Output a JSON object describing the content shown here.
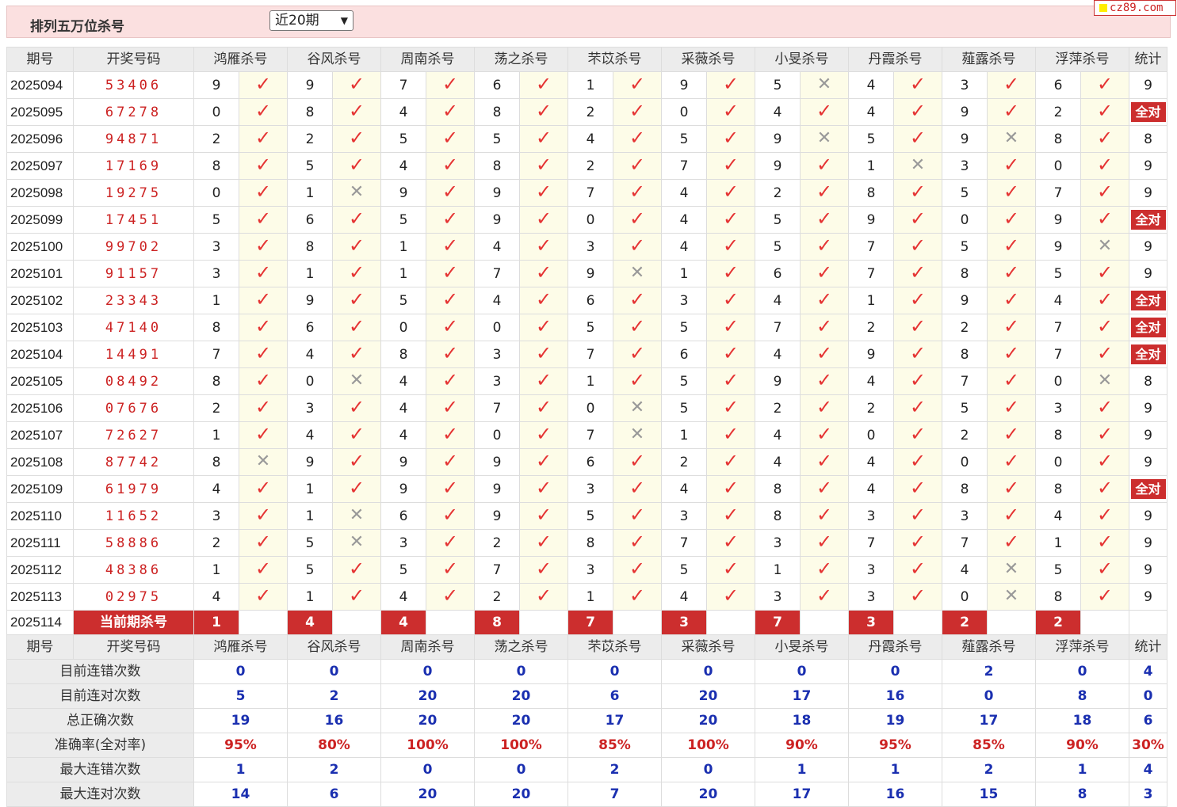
{
  "header": {
    "title": "排列五万位杀号",
    "period_select": "近20期",
    "watermark": "cz89.com"
  },
  "columns": {
    "issue": "期号",
    "draw": "开奖号码",
    "experts": [
      "鸿雁杀号",
      "谷风杀号",
      "周南杀号",
      "荡之杀号",
      "芣苡杀号",
      "采薇杀号",
      "小旻杀号",
      "丹霞杀号",
      "薤露杀号",
      "浮萍杀号"
    ],
    "stat": "统计"
  },
  "all_right_label": "全对",
  "rows": [
    {
      "issue": "2025094",
      "draw": "53406",
      "kills": [
        "9",
        "9",
        "7",
        "6",
        "1",
        "9",
        "5",
        "4",
        "3",
        "6"
      ],
      "ok": [
        1,
        1,
        1,
        1,
        1,
        1,
        0,
        1,
        1,
        1
      ],
      "sum": "9"
    },
    {
      "issue": "2025095",
      "draw": "67278",
      "kills": [
        "0",
        "8",
        "4",
        "8",
        "2",
        "0",
        "4",
        "4",
        "9",
        "2"
      ],
      "ok": [
        1,
        1,
        1,
        1,
        1,
        1,
        1,
        1,
        1,
        1
      ],
      "sum": "全对"
    },
    {
      "issue": "2025096",
      "draw": "94871",
      "kills": [
        "2",
        "2",
        "5",
        "5",
        "4",
        "5",
        "9",
        "5",
        "9",
        "8"
      ],
      "ok": [
        1,
        1,
        1,
        1,
        1,
        1,
        0,
        1,
        0,
        1
      ],
      "sum": "8"
    },
    {
      "issue": "2025097",
      "draw": "17169",
      "kills": [
        "8",
        "5",
        "4",
        "8",
        "2",
        "7",
        "9",
        "1",
        "3",
        "0"
      ],
      "ok": [
        1,
        1,
        1,
        1,
        1,
        1,
        1,
        0,
        1,
        1
      ],
      "sum": "9"
    },
    {
      "issue": "2025098",
      "draw": "19275",
      "kills": [
        "0",
        "1",
        "9",
        "9",
        "7",
        "4",
        "2",
        "8",
        "5",
        "7"
      ],
      "ok": [
        1,
        0,
        1,
        1,
        1,
        1,
        1,
        1,
        1,
        1
      ],
      "sum": "9"
    },
    {
      "issue": "2025099",
      "draw": "17451",
      "kills": [
        "5",
        "6",
        "5",
        "9",
        "0",
        "4",
        "5",
        "9",
        "0",
        "9"
      ],
      "ok": [
        1,
        1,
        1,
        1,
        1,
        1,
        1,
        1,
        1,
        1
      ],
      "sum": "全对"
    },
    {
      "issue": "2025100",
      "draw": "99702",
      "kills": [
        "3",
        "8",
        "1",
        "4",
        "3",
        "4",
        "5",
        "7",
        "5",
        "9"
      ],
      "ok": [
        1,
        1,
        1,
        1,
        1,
        1,
        1,
        1,
        1,
        0
      ],
      "sum": "9"
    },
    {
      "issue": "2025101",
      "draw": "91157",
      "kills": [
        "3",
        "1",
        "1",
        "7",
        "9",
        "1",
        "6",
        "7",
        "8",
        "5"
      ],
      "ok": [
        1,
        1,
        1,
        1,
        0,
        1,
        1,
        1,
        1,
        1
      ],
      "sum": "9"
    },
    {
      "issue": "2025102",
      "draw": "23343",
      "kills": [
        "1",
        "9",
        "5",
        "4",
        "6",
        "3",
        "4",
        "1",
        "9",
        "4"
      ],
      "ok": [
        1,
        1,
        1,
        1,
        1,
        1,
        1,
        1,
        1,
        1
      ],
      "sum": "全对"
    },
    {
      "issue": "2025103",
      "draw": "47140",
      "kills": [
        "8",
        "6",
        "0",
        "0",
        "5",
        "5",
        "7",
        "2",
        "2",
        "7"
      ],
      "ok": [
        1,
        1,
        1,
        1,
        1,
        1,
        1,
        1,
        1,
        1
      ],
      "sum": "全对"
    },
    {
      "issue": "2025104",
      "draw": "14491",
      "kills": [
        "7",
        "4",
        "8",
        "3",
        "7",
        "6",
        "4",
        "9",
        "8",
        "7"
      ],
      "ok": [
        1,
        1,
        1,
        1,
        1,
        1,
        1,
        1,
        1,
        1
      ],
      "sum": "全对"
    },
    {
      "issue": "2025105",
      "draw": "08492",
      "kills": [
        "8",
        "0",
        "4",
        "3",
        "1",
        "5",
        "9",
        "4",
        "7",
        "0"
      ],
      "ok": [
        1,
        0,
        1,
        1,
        1,
        1,
        1,
        1,
        1,
        0
      ],
      "sum": "8"
    },
    {
      "issue": "2025106",
      "draw": "07676",
      "kills": [
        "2",
        "3",
        "4",
        "7",
        "0",
        "5",
        "2",
        "2",
        "5",
        "3"
      ],
      "ok": [
        1,
        1,
        1,
        1,
        0,
        1,
        1,
        1,
        1,
        1
      ],
      "sum": "9"
    },
    {
      "issue": "2025107",
      "draw": "72627",
      "kills": [
        "1",
        "4",
        "4",
        "0",
        "7",
        "1",
        "4",
        "0",
        "2",
        "8"
      ],
      "ok": [
        1,
        1,
        1,
        1,
        0,
        1,
        1,
        1,
        1,
        1
      ],
      "sum": "9"
    },
    {
      "issue": "2025108",
      "draw": "87742",
      "kills": [
        "8",
        "9",
        "9",
        "9",
        "6",
        "2",
        "4",
        "4",
        "0",
        "0"
      ],
      "ok": [
        0,
        1,
        1,
        1,
        1,
        1,
        1,
        1,
        1,
        1
      ],
      "sum": "9"
    },
    {
      "issue": "2025109",
      "draw": "61979",
      "kills": [
        "4",
        "1",
        "9",
        "9",
        "3",
        "4",
        "8",
        "4",
        "8",
        "8"
      ],
      "ok": [
        1,
        1,
        1,
        1,
        1,
        1,
        1,
        1,
        1,
        1
      ],
      "sum": "全对"
    },
    {
      "issue": "2025110",
      "draw": "11652",
      "kills": [
        "3",
        "1",
        "6",
        "9",
        "5",
        "3",
        "8",
        "3",
        "3",
        "4"
      ],
      "ok": [
        1,
        0,
        1,
        1,
        1,
        1,
        1,
        1,
        1,
        1
      ],
      "sum": "9"
    },
    {
      "issue": "2025111",
      "draw": "58886",
      "kills": [
        "2",
        "5",
        "3",
        "2",
        "8",
        "7",
        "3",
        "7",
        "7",
        "1"
      ],
      "ok": [
        1,
        0,
        1,
        1,
        1,
        1,
        1,
        1,
        1,
        1
      ],
      "sum": "9"
    },
    {
      "issue": "2025112",
      "draw": "48386",
      "kills": [
        "1",
        "5",
        "5",
        "7",
        "3",
        "5",
        "1",
        "3",
        "4",
        "5"
      ],
      "ok": [
        1,
        1,
        1,
        1,
        1,
        1,
        1,
        1,
        0,
        1
      ],
      "sum": "9"
    },
    {
      "issue": "2025113",
      "draw": "02975",
      "kills": [
        "4",
        "1",
        "4",
        "2",
        "1",
        "4",
        "3",
        "3",
        "0",
        "8"
      ],
      "ok": [
        1,
        1,
        1,
        1,
        1,
        1,
        1,
        1,
        0,
        1
      ],
      "sum": "9"
    }
  ],
  "current": {
    "issue": "2025114",
    "label": "当前期杀号",
    "kills": [
      "1",
      "4",
      "4",
      "8",
      "7",
      "3",
      "7",
      "3",
      "2",
      "2"
    ]
  },
  "stats": [
    {
      "label": "目前连错次数",
      "values": [
        "0",
        "0",
        "0",
        "0",
        "0",
        "0",
        "0",
        "0",
        "2",
        "0"
      ],
      "sum": "4",
      "kind": "count"
    },
    {
      "label": "目前连对次数",
      "values": [
        "5",
        "2",
        "20",
        "20",
        "6",
        "20",
        "17",
        "16",
        "0",
        "8"
      ],
      "sum": "0",
      "kind": "count"
    },
    {
      "label": "总正确次数",
      "values": [
        "19",
        "16",
        "20",
        "20",
        "17",
        "20",
        "18",
        "19",
        "17",
        "18"
      ],
      "sum": "6",
      "kind": "count"
    },
    {
      "label": "准确率(全对率)",
      "values": [
        "95%",
        "80%",
        "100%",
        "100%",
        "85%",
        "100%",
        "90%",
        "95%",
        "85%",
        "90%"
      ],
      "sum": "30%",
      "kind": "rate"
    },
    {
      "label": "最大连错次数",
      "values": [
        "1",
        "2",
        "0",
        "0",
        "2",
        "0",
        "1",
        "1",
        "2",
        "1"
      ],
      "sum": "4",
      "kind": "count"
    },
    {
      "label": "最大连对次数",
      "values": [
        "14",
        "6",
        "20",
        "20",
        "7",
        "20",
        "17",
        "16",
        "15",
        "8"
      ],
      "sum": "3",
      "kind": "count"
    }
  ],
  "icons": {
    "check": "check-icon",
    "cross": "cross-icon"
  },
  "colors": {
    "accent_red": "#cc2e2e",
    "stat_blue": "#1a2fb0",
    "result_bg": "#fdfce8",
    "header_bg": "#ececec",
    "topbar_bg": "#fbe0e0"
  }
}
